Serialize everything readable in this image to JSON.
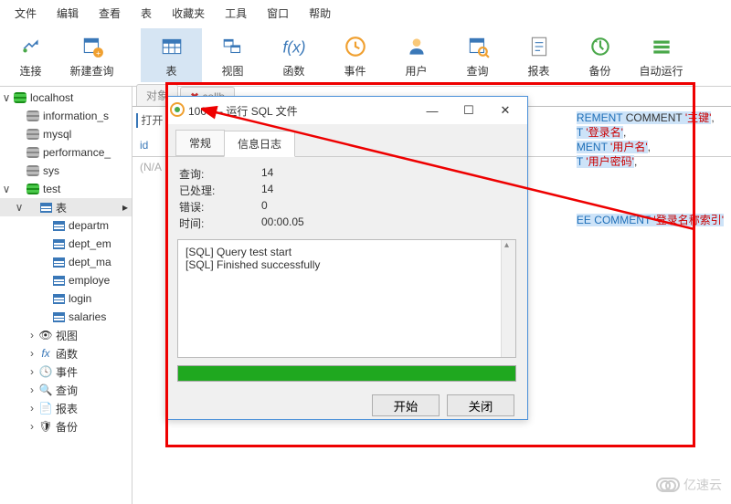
{
  "menu": [
    "文件",
    "编辑",
    "查看",
    "表",
    "收藏夹",
    "工具",
    "窗口",
    "帮助"
  ],
  "toolbar": [
    {
      "label": "连接",
      "name": "connect"
    },
    {
      "label": "新建查询",
      "name": "new-query"
    },
    {
      "label": "表",
      "name": "table",
      "active": true
    },
    {
      "label": "视图",
      "name": "view"
    },
    {
      "label": "函数",
      "name": "function"
    },
    {
      "label": "事件",
      "name": "event"
    },
    {
      "label": "用户",
      "name": "user"
    },
    {
      "label": "查询",
      "name": "query"
    },
    {
      "label": "报表",
      "name": "report"
    },
    {
      "label": "备份",
      "name": "backup"
    },
    {
      "label": "自动运行",
      "name": "schedule"
    }
  ],
  "tree": {
    "conn": "localhost",
    "sysdbs": [
      "information_s",
      "mysql",
      "performance_",
      "sys"
    ],
    "userdb": "test",
    "tables_label": "表",
    "tables": [
      "departm",
      "dept_em",
      "dept_ma",
      "employe",
      "login",
      "salaries"
    ],
    "others": [
      {
        "label": "视图",
        "name": "views"
      },
      {
        "label": "函数",
        "name": "functions"
      },
      {
        "label": "事件",
        "name": "events"
      },
      {
        "label": "查询",
        "name": "queries"
      },
      {
        "label": "报表",
        "name": "reports"
      },
      {
        "label": "备份",
        "name": "backups"
      }
    ]
  },
  "content": {
    "obj_tab": "对象",
    "open_btn": "打开",
    "tab2": "collb",
    "col_id": "id",
    "na": "(N/A"
  },
  "sql": {
    "l1a": "REMENT",
    "l1b": "  COMMENT",
    "l1c": "'主键'",
    "l1d": ",",
    "l2a": "T",
    "l2b": "'登录名'",
    "l2c": ",",
    "l3a": "MENT",
    "l3b": "'用户名'",
    "l3c": ",",
    "l4a": "T",
    "l4b": "'用户密码'",
    "l4c": ",",
    "l5a": "EE",
    "l5b": "COMMENT",
    "l5c": "'登录名称索引'"
  },
  "dialog": {
    "title": "100% - 运行 SQL 文件",
    "tabs": [
      "常规",
      "信息日志"
    ],
    "stats": [
      {
        "k": "查询:",
        "v": "14"
      },
      {
        "k": "已处理:",
        "v": "14"
      },
      {
        "k": "错误:",
        "v": "0"
      },
      {
        "k": "时间:",
        "v": "00:00.05"
      }
    ],
    "log": [
      "[SQL] Query test start",
      "[SQL] Finished successfully"
    ],
    "progress_pct": 100,
    "btn_start": "开始",
    "btn_close": "关闭"
  },
  "watermark": "亿速云"
}
